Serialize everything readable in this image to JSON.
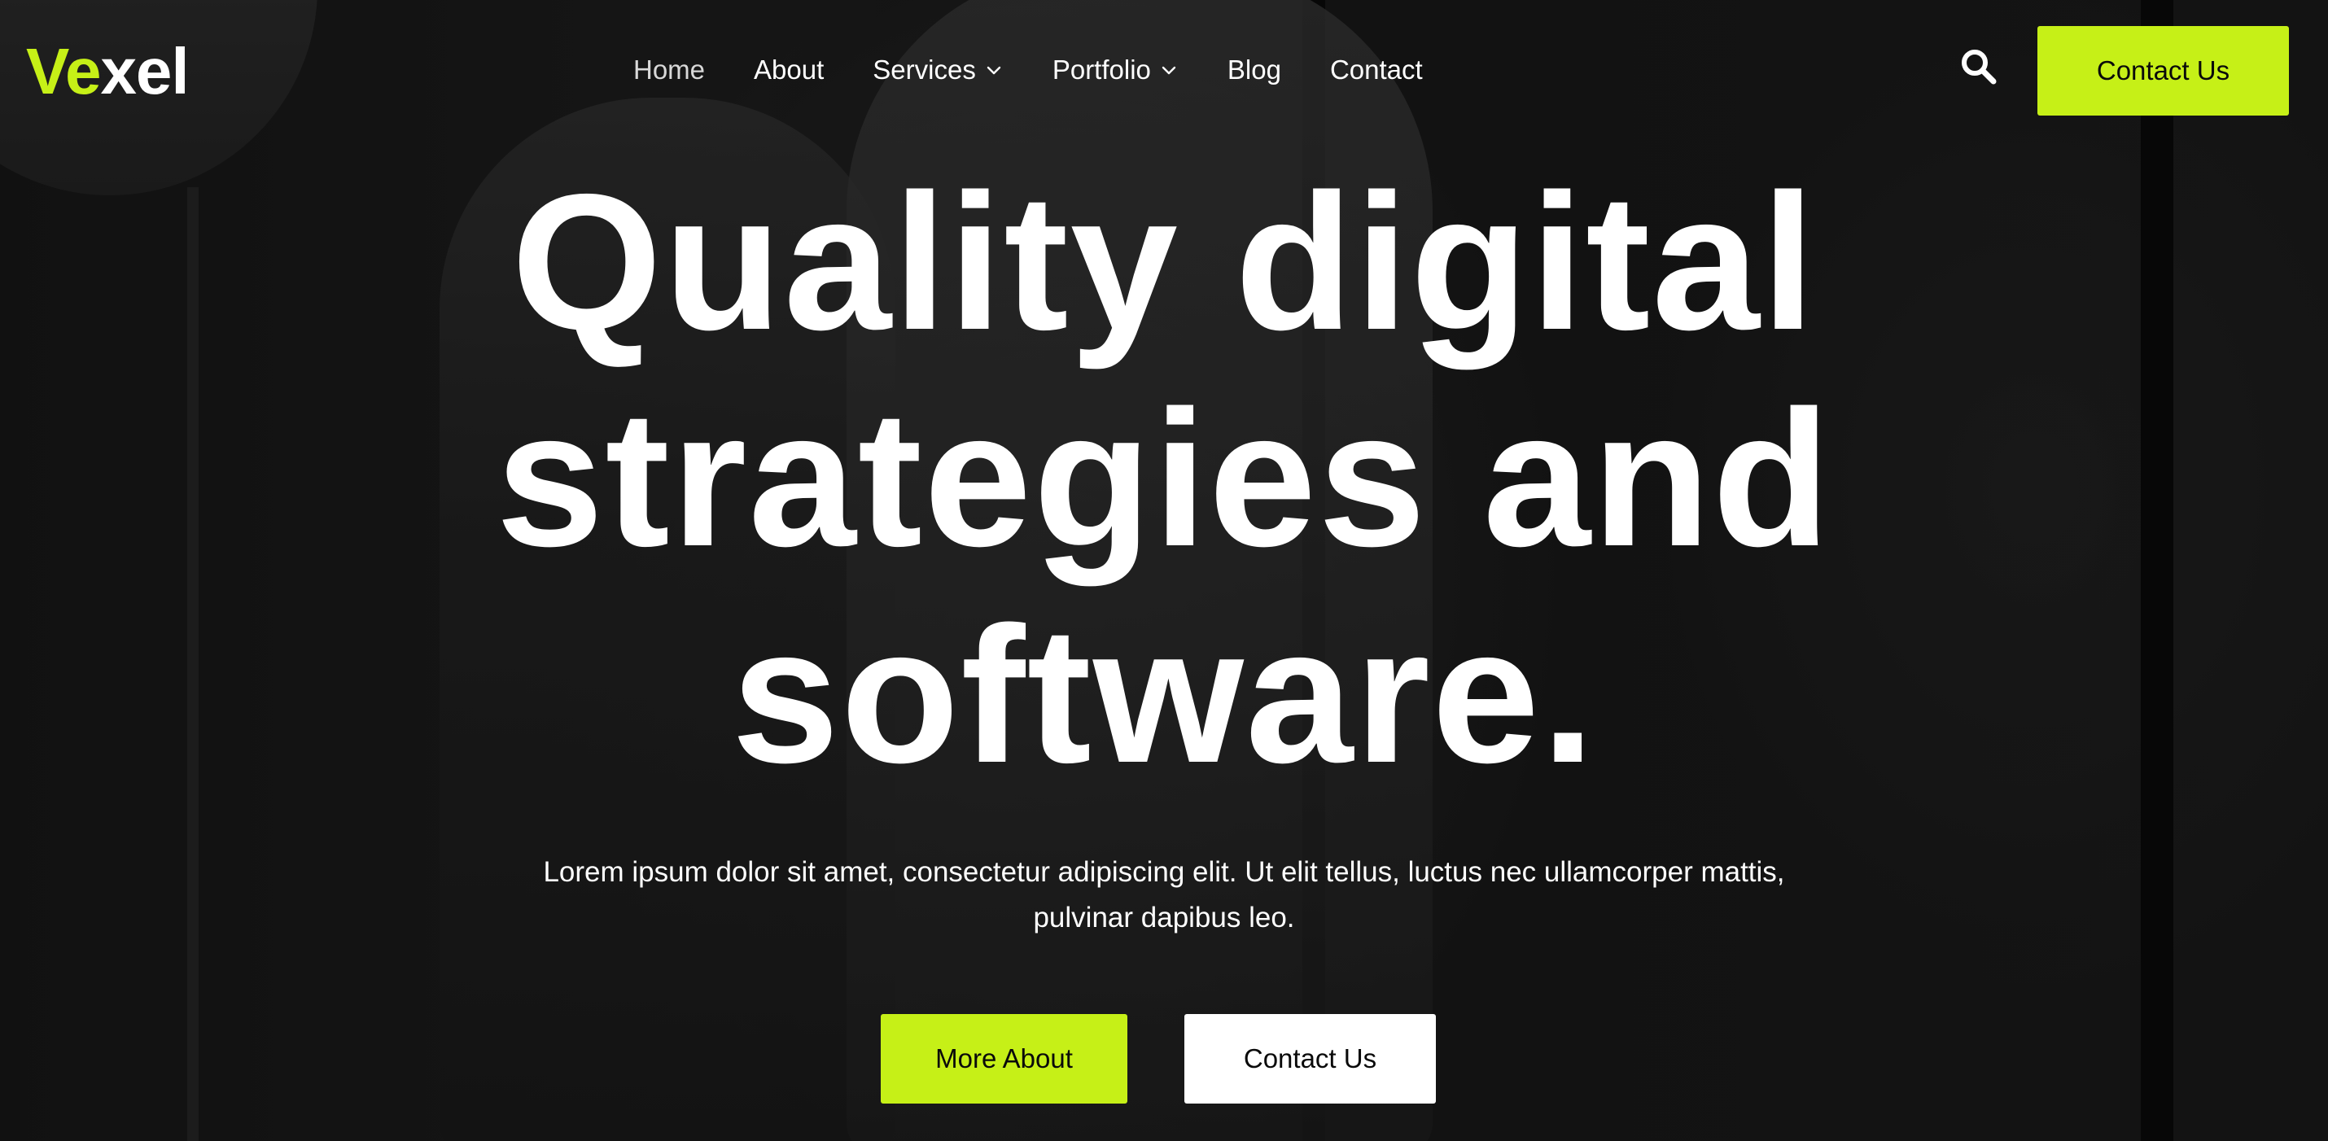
{
  "brand": {
    "logo_part1": "Ve",
    "logo_part2": "xel",
    "accent_color": "#c6f017"
  },
  "nav": {
    "items": [
      {
        "label": "Home",
        "active": true
      },
      {
        "label": "About"
      },
      {
        "label": "Services",
        "has_dropdown": true
      },
      {
        "label": "Portfolio",
        "has_dropdown": true
      },
      {
        "label": "Blog"
      },
      {
        "label": "Contact"
      }
    ],
    "search_icon": "search-icon",
    "cta_label": "Contact Us"
  },
  "hero": {
    "headline_lines": [
      "Quality digital",
      "strategies and",
      "software."
    ],
    "lead_line1": "Lorem ipsum dolor sit amet, consectetur adipiscing elit. Ut elit tellus, luctus nec ullamcorper mattis,",
    "lead_line2": "pulvinar dapibus leo.",
    "primary_button": "More About",
    "secondary_button": "Contact Us"
  }
}
